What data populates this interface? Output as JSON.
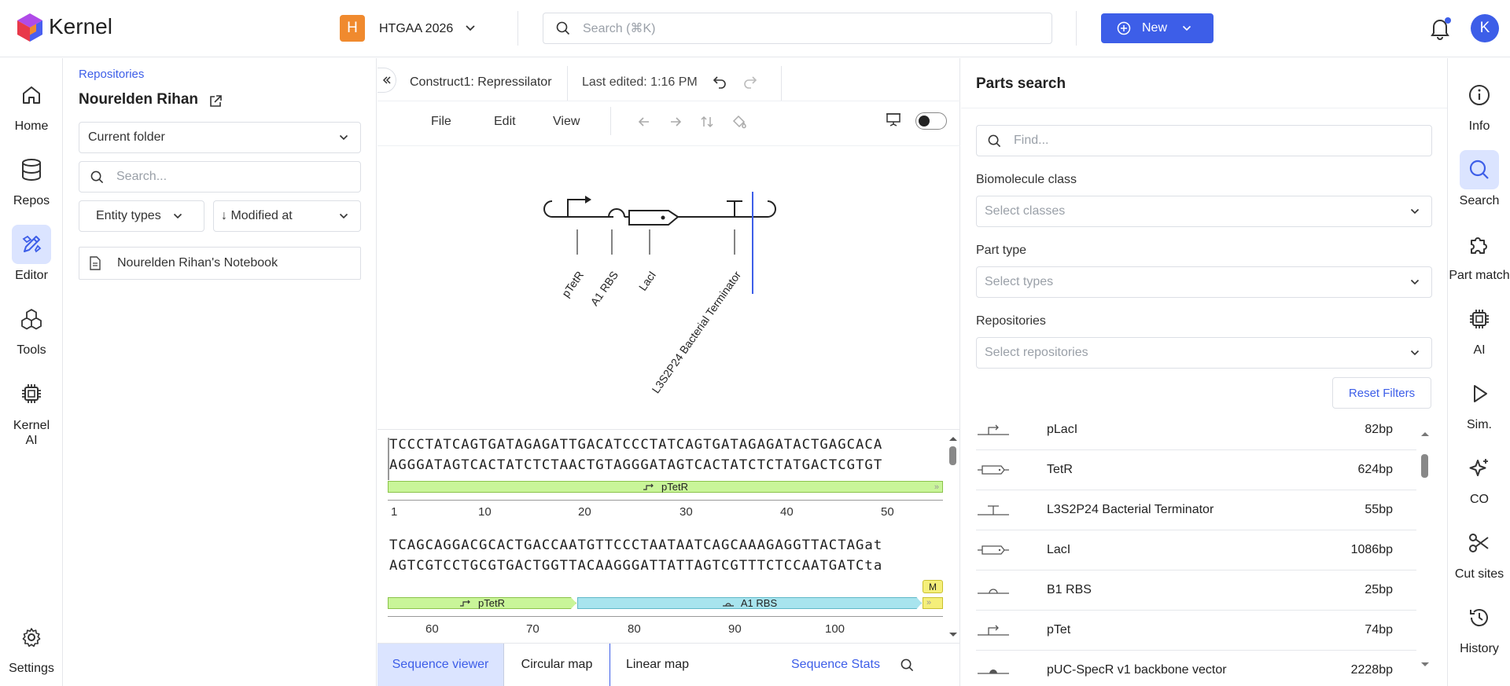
{
  "app": {
    "name": "Kernel"
  },
  "workspace": {
    "initial": "H",
    "name": "HTGAA 2026",
    "color": "#f08a2e"
  },
  "search": {
    "placeholder": "Search (⌘K)"
  },
  "new_button": {
    "label": "New"
  },
  "user": {
    "initial": "K"
  },
  "colors": {
    "accent": "#3d5ee8",
    "active_bg": "#dbe4ff",
    "feature_green": "#c9f599",
    "feature_cyan": "#a8e4ee",
    "feature_yellow": "#f5ef7a"
  },
  "left_rail": [
    {
      "label": "Home",
      "icon": "home-icon"
    },
    {
      "label": "Repos",
      "icon": "database-icon"
    },
    {
      "label": "Editor",
      "icon": "editor-icon",
      "active": true
    },
    {
      "label": "Tools",
      "icon": "tools-icon"
    },
    {
      "label": "Kernel AI",
      "icon": "chip-icon"
    },
    {
      "label": "Settings",
      "icon": "gear-icon"
    }
  ],
  "repo_panel": {
    "breadcrumb": "Repositories",
    "owner": "Nourelden Rihan",
    "folder_select": "Current folder",
    "search_placeholder": "Search...",
    "entity_filter": "Entity types",
    "sort_filter": "↓ Modified at",
    "items": [
      {
        "name": "Nourelden Rihan's Notebook",
        "icon": "document-icon"
      }
    ]
  },
  "editor": {
    "title": "Construct1: Repressilator",
    "last_edited": "Last edited: 1:16 PM",
    "menus": [
      "File",
      "Edit",
      "View"
    ],
    "design_labels": [
      "pTetR",
      "A1 RBS",
      "LacI",
      "L3S2P24 Bacterial Terminator"
    ],
    "seq_block1": {
      "top": "TCCCTATCAGTGATAGAGATTGACATCCCTATCAGTGATAGAGATACTGAGCACA",
      "bottom": "AGGGATAGTCACTATCTCTAACTGTAGGGATAGTCACTATCTCTATGACTCGTGT",
      "feature": "pTetR",
      "ruler": [
        "1",
        "10",
        "20",
        "30",
        "40",
        "50"
      ]
    },
    "seq_block2": {
      "top": "TCAGCAGGACGCACTGACCAATGTTCCCTAATAATCAGCAAAGAGGTTACTAGat",
      "bottom": "AGTCGTCCTGCGTGACTGGTTACAAGGGATTATTAGTCGTTTCTCCAATGATCta",
      "features": [
        "pTetR",
        "A1 RBS"
      ],
      "marker": "M",
      "ruler": [
        "60",
        "70",
        "80",
        "90",
        "100"
      ]
    },
    "tabs": [
      "Sequence viewer",
      "Circular map",
      "Linear map"
    ],
    "stats_link": "Sequence Stats"
  },
  "parts_search": {
    "title": "Parts search",
    "find_placeholder": "Find...",
    "filters": [
      {
        "label": "Biomolecule class",
        "placeholder": "Select classes"
      },
      {
        "label": "Part type",
        "placeholder": "Select types"
      },
      {
        "label": "Repositories",
        "placeholder": "Select repositories"
      }
    ],
    "reset_label": "Reset Filters",
    "parts": [
      {
        "name": "pLacI",
        "size": "82bp",
        "icon": "promoter-icon"
      },
      {
        "name": "TetR",
        "size": "624bp",
        "icon": "cds-icon"
      },
      {
        "name": "L3S2P24 Bacterial Terminator",
        "size": "55bp",
        "icon": "terminator-icon"
      },
      {
        "name": "LacI",
        "size": "1086bp",
        "icon": "cds-icon"
      },
      {
        "name": "B1 RBS",
        "size": "25bp",
        "icon": "rbs-icon"
      },
      {
        "name": "pTet",
        "size": "74bp",
        "icon": "promoter-icon"
      },
      {
        "name": "pUC-SpecR v1 backbone vector",
        "size": "2228bp",
        "icon": "backbone-icon"
      }
    ]
  },
  "right_rail": [
    {
      "label": "Info",
      "icon": "info-icon"
    },
    {
      "label": "Search",
      "icon": "search-icon",
      "active": true
    },
    {
      "label": "Part match",
      "icon": "puzzle-icon"
    },
    {
      "label": "AI",
      "icon": "chip-icon"
    },
    {
      "label": "Sim.",
      "icon": "play-icon"
    },
    {
      "label": "CO",
      "icon": "sparkle-icon"
    },
    {
      "label": "Cut sites",
      "icon": "scissors-icon"
    },
    {
      "label": "History",
      "icon": "history-icon"
    }
  ]
}
